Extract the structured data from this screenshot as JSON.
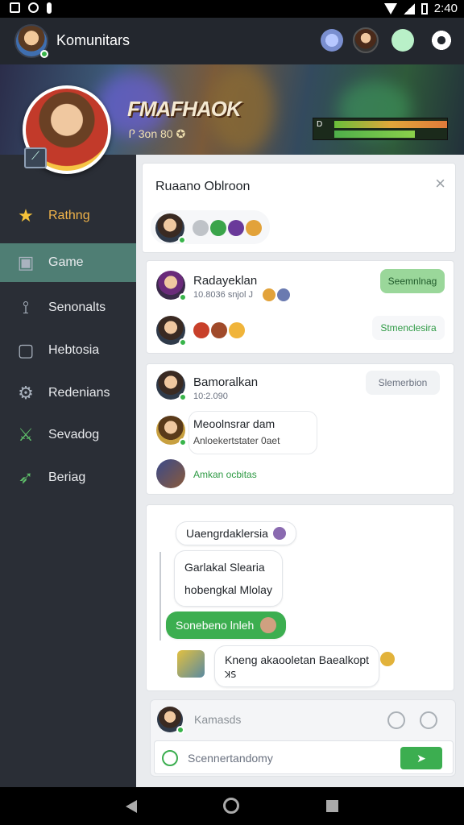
{
  "status_bar": {
    "time": "2:40"
  },
  "app_bar": {
    "title": "Komunitars"
  },
  "banner": {
    "title": "FMAFHAOK",
    "subtitle": "Ꮅ 3on 80 ✪",
    "stat_label": "D"
  },
  "sidebar": {
    "items": [
      {
        "label": "Rathng",
        "icon": "star-icon",
        "active": false
      },
      {
        "label": "Game",
        "icon": "game-icon",
        "active": true
      },
      {
        "label": "Senonalts",
        "icon": "social-icon",
        "active": false
      },
      {
        "label": "Hebtosia",
        "icon": "document-icon",
        "active": false
      },
      {
        "label": "Redenians",
        "icon": "gear-people-icon",
        "active": false
      },
      {
        "label": "Sevadog",
        "icon": "sword-icon",
        "active": false
      },
      {
        "label": "Beriag",
        "icon": "arrow-icon",
        "active": false
      }
    ]
  },
  "room": {
    "title": "Ruaano Oblroon"
  },
  "card1": {
    "name": "Radayeklan",
    "sub": "10.8036 snjol J",
    "button": "Seemnlnag",
    "row2_link": "Stmenclesira"
  },
  "card2": {
    "name": "Bamoralkan",
    "sub": "10:2.090",
    "button": "Slemerbion",
    "msg_line1": "Meoolnsrar dam",
    "msg_line2": "Anloekertstater 0aet",
    "link": "Amkan ocbitas"
  },
  "chat": {
    "b1": "Uaengrdaklersia",
    "b2_line1": "Garlakal Slearia",
    "b2_line2": "hobengkal Mlolay",
    "b3": "Sonebeno lnleh",
    "b4_line1": "Kneng akaooletan Baealkopt",
    "b4_line2": "ꓘꓢ"
  },
  "composer": {
    "placeholder1": "Kamasds",
    "placeholder2": "Scennertandomy"
  },
  "colors": {
    "accent": "#4f7e74",
    "green": "#3cae50",
    "sidebar": "#2a2e36"
  }
}
